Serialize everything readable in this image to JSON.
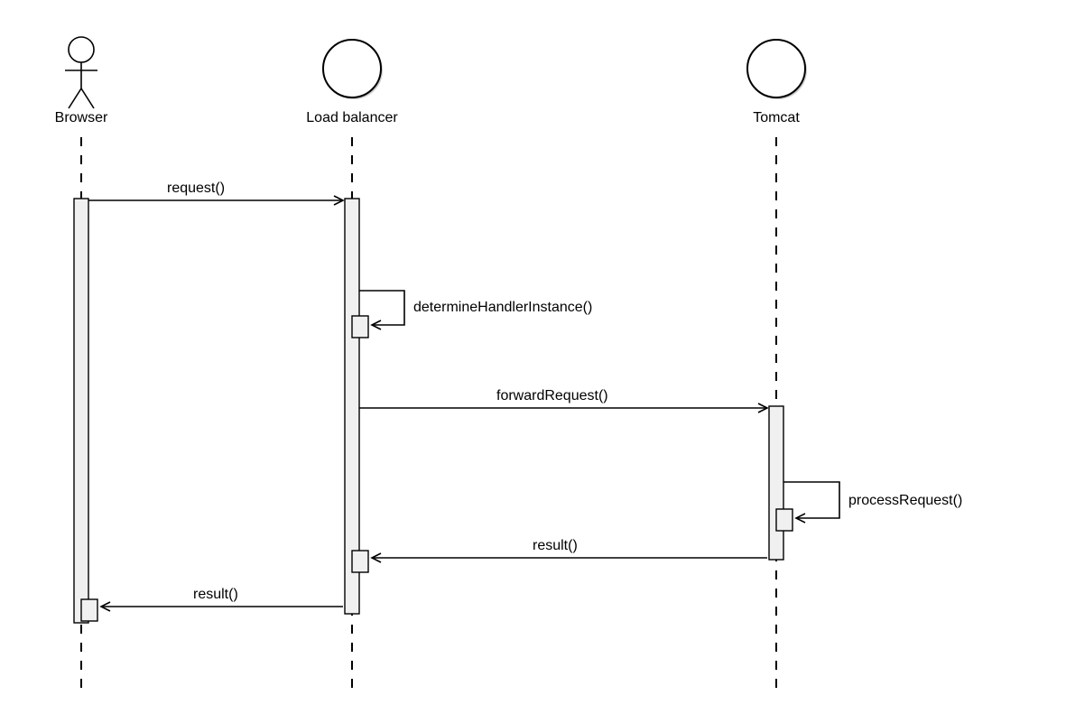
{
  "participants": {
    "browser": {
      "label": "Browser"
    },
    "lb": {
      "label": "Load balancer"
    },
    "tomcat": {
      "label": "Tomcat"
    }
  },
  "messages": {
    "m1": {
      "label": "request()"
    },
    "m2": {
      "label": "determineHandlerInstance()"
    },
    "m3": {
      "label": "forwardRequest()"
    },
    "m4": {
      "label": "processRequest()"
    },
    "m5": {
      "label": "result()"
    },
    "m6": {
      "label": "result()"
    }
  }
}
